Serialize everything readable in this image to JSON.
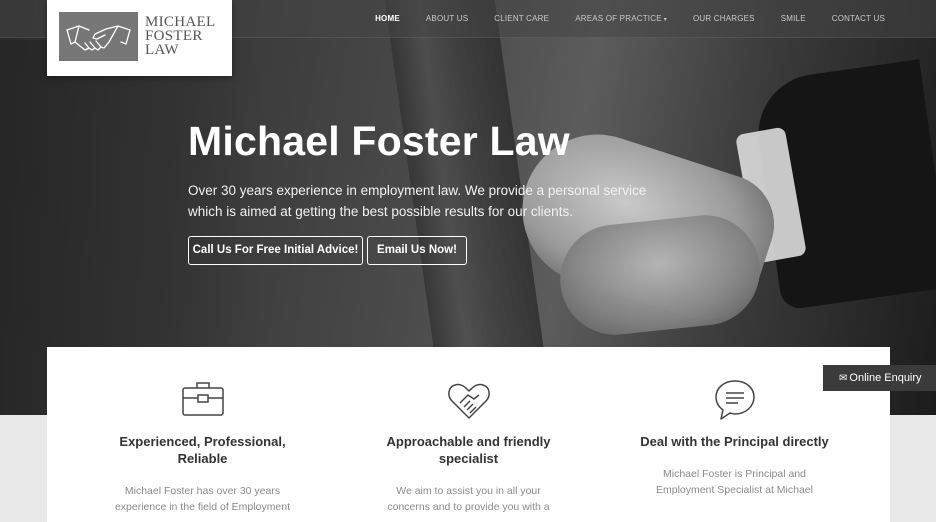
{
  "logo": {
    "line1": "MICHAEL",
    "line2": "FOSTER",
    "line3": "LAW"
  },
  "nav": {
    "items": [
      "HOME",
      "ABOUT US",
      "CLIENT CARE",
      "AREAS OF PRACTICE",
      "OUR CHARGES",
      "SMILE",
      "CONTACT US"
    ],
    "caret": "▾"
  },
  "hero": {
    "title": "Michael Foster Law",
    "subtitle": "Over 30 years experience in employment law. We provide a personal service which is aimed at getting the best possible results for our clients.",
    "call_button": "Call Us For Free Initial Advice!",
    "email_button": "Email Us Now!"
  },
  "features": [
    {
      "icon": "briefcase-icon",
      "title": "Experienced, Professional, Reliable",
      "text": "Michael Foster has over 30 years experience in the field of Employment"
    },
    {
      "icon": "handshake-heart-icon",
      "title": "Approachable and friendly specialist",
      "text": "We aim to assist you in all your concerns and to provide you with a"
    },
    {
      "icon": "speech-bubble-icon",
      "title": "Deal with the Principal directly",
      "text": "Michael Foster is Principal and Employment Specialist at Michael"
    }
  ],
  "enquiry": {
    "label": "Online Enquiry",
    "icon": "envelope-icon"
  },
  "colors": {
    "nav_bg": "#464646",
    "enquiry_bg": "#3b3b3b",
    "title_text": "#333333"
  }
}
